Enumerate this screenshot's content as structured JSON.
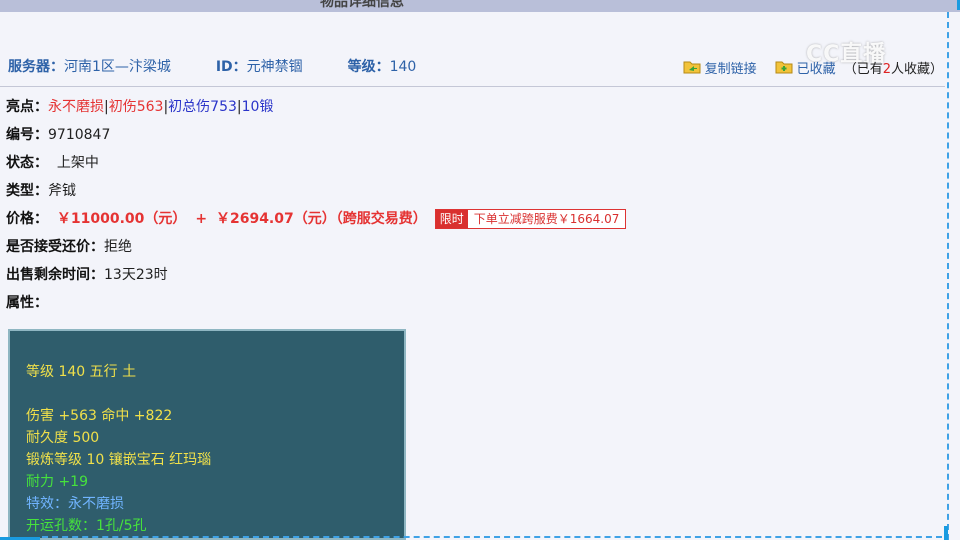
{
  "page": {
    "title": "物品详细信息"
  },
  "header": {
    "server_label": "服务器：",
    "server_value": "河南1区—汴梁城",
    "id_label": "ID：",
    "id_value": "元神禁锢",
    "level_label": "等级：",
    "level_value": "140",
    "copy_link": "复制链接",
    "favorited": "已收藏",
    "fav_note_prefix": "（已有",
    "fav_count": "2",
    "fav_note_suffix": "人收藏）"
  },
  "watermark": "CC直播",
  "info": {
    "highlights_label": "亮点：",
    "highlights": [
      "永不磨损",
      "初伤563",
      "初总伤753",
      "10锻"
    ],
    "sep": "|",
    "number_label": "编号：",
    "number_value": "9710847",
    "status_label": "状态：",
    "status_value": "上架中",
    "type_label": "类型：",
    "type_value": "斧钺",
    "price_label": "价格：",
    "price_main": "￥11000.00（元）",
    "price_plus": "+",
    "price_fee": "￥2694.07（元）（跨服交易费）",
    "badge": "限时",
    "badge_text": "下单立减跨服费￥1664.07",
    "bargain_label": "是否接受还价：",
    "bargain_value": "拒绝",
    "remain_label": "出售剩余时间：",
    "remain_value": "13天23时",
    "attr_label": "属性："
  },
  "attributes": {
    "level_line": "等级 140 五行 土",
    "damage_line": "伤害 +563 命中 +822",
    "durability_line": "耐久度 500",
    "forge_line": "锻炼等级 10 镶嵌宝石 红玛瑙",
    "stamina_line": "耐力 +19",
    "effect_line": "特效：永不磨损",
    "holes_line": "开运孔数：1孔/5孔"
  },
  "colors": {
    "accent_blue": "#2e62a8",
    "price_red": "#e53333",
    "attr_bg": "#2f5d6c"
  }
}
